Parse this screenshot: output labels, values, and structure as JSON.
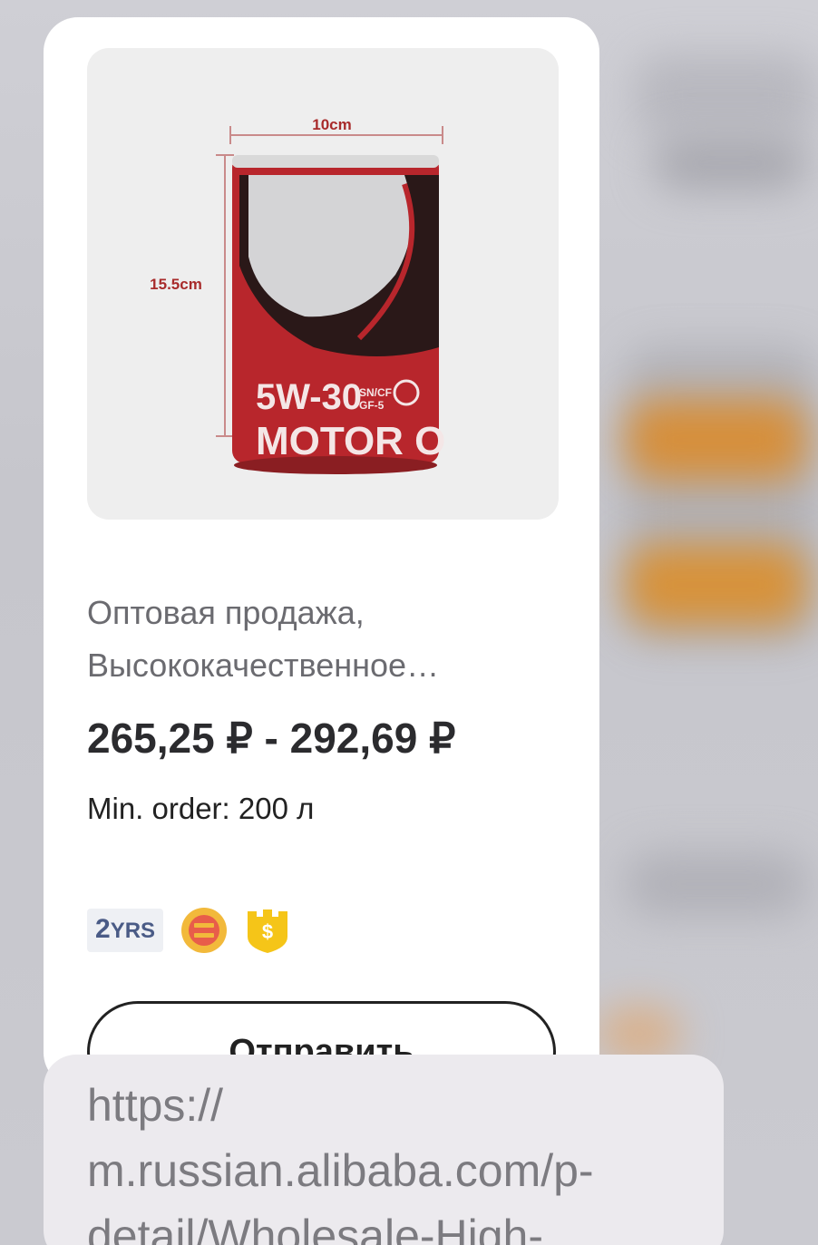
{
  "product": {
    "image": {
      "can_label": "5W-30",
      "spec_top": "SN/CF",
      "spec_bottom": "GF-5",
      "brand_text": "MOTOR O",
      "width_label": "10cm",
      "height_label": "15.5cm"
    },
    "title_line1": "Оптовая продажа,",
    "title_line2": "Высококачественное…",
    "price": "265,25 ₽ - 292,69 ₽",
    "min_order": "Min. order: 200 л",
    "badges": {
      "years_number": "2",
      "years_suffix": "YRS",
      "supplier_icon": "verified-supplier-icon",
      "trade_assurance_icon": "trade-assurance-icon"
    },
    "send_button_label": "Отправить"
  },
  "link_preview": {
    "url_line1": "https://",
    "url_line2": "m.russian.alibaba.com/p-",
    "url_line3": "detail/Wholesale-High-"
  },
  "colors": {
    "can_red": "#b8262c",
    "can_dark": "#2a1818",
    "badge_gold": "#f2b93b",
    "years_blue": "#4a5b86"
  }
}
